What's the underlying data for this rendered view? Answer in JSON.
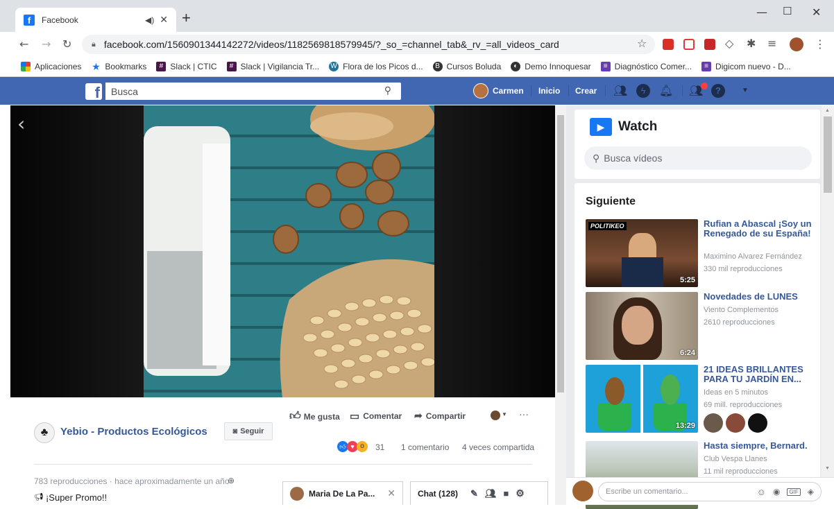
{
  "browser": {
    "tab_title": "Facebook",
    "url": "facebook.com/1560901344142272/videos/1182569818579945/?_so_=channel_tab&_rv_=all_videos_card",
    "bookmarks": [
      {
        "label": "Aplicaciones",
        "icon": "apps-grid-icon",
        "color": "#e53935"
      },
      {
        "label": "Bookmarks",
        "icon": "star-icon",
        "color": "#1a73e8"
      },
      {
        "label": "Slack | CTIC",
        "icon": "slack-icon",
        "color": "#4a154b"
      },
      {
        "label": "Slack | Vigilancia Tr...",
        "icon": "slack-icon",
        "color": "#4a154b"
      },
      {
        "label": "Flora de los Picos d...",
        "icon": "wordpress-icon",
        "color": "#21759b"
      },
      {
        "label": "Cursos Boluda",
        "icon": "b-circle-icon",
        "color": "#333333"
      },
      {
        "label": "Demo Innoquesar",
        "icon": "globe-icon",
        "color": "#333333"
      },
      {
        "label": "Diagnóstico Comer...",
        "icon": "forms-icon",
        "color": "#673ab7"
      },
      {
        "label": "Digicom nuevo - D...",
        "icon": "forms-icon",
        "color": "#673ab7"
      }
    ]
  },
  "fb": {
    "search_placeholder": "Busca",
    "user_name": "Carmen",
    "home": "Inicio",
    "create": "Crear",
    "brand_color": "#4267b2"
  },
  "post": {
    "page_name": "Yebio - Productos Ecológicos",
    "follow": "Seguir",
    "like": "Me gusta",
    "comment": "Comentar",
    "share": "Compartir",
    "reactions_count": "31",
    "comments_count": "1 comentario",
    "shares_count": "4 veces compartida",
    "views_time": "783 reproducciones · hace aproximadamente un año ·",
    "caption": "¡Super Promo!!"
  },
  "watch": {
    "title": "Watch",
    "search_placeholder": "Busca vídeos"
  },
  "next": {
    "heading": "Siguiente",
    "videos": [
      {
        "title": "Rufian a Abascal ¡Soy un Renegado de su España!",
        "channel": "Maximino Alvarez Fernández",
        "views": "330 mil reproducciones",
        "duration": "5:25"
      },
      {
        "title": "Novedades de LUNES",
        "channel": "Viento Complementos",
        "views": "2610 reproducciones",
        "duration": "6:24"
      },
      {
        "title": "21 IDEAS BRILLANTES PARA TU JARDÍN EN...",
        "channel": "Ideas en 5 minutos",
        "views": "69 mill. reproducciones",
        "duration": "13:29"
      },
      {
        "title": "Hasta siempre, Bernard.",
        "channel": "Club Vespa Llanes",
        "views": "11 mil reproducciones",
        "duration": ""
      }
    ]
  },
  "chat": {
    "contact": "Maria De La Pa...",
    "chat_label": "Chat (128)"
  },
  "comment_placeholder": "Escribe un comentario..."
}
